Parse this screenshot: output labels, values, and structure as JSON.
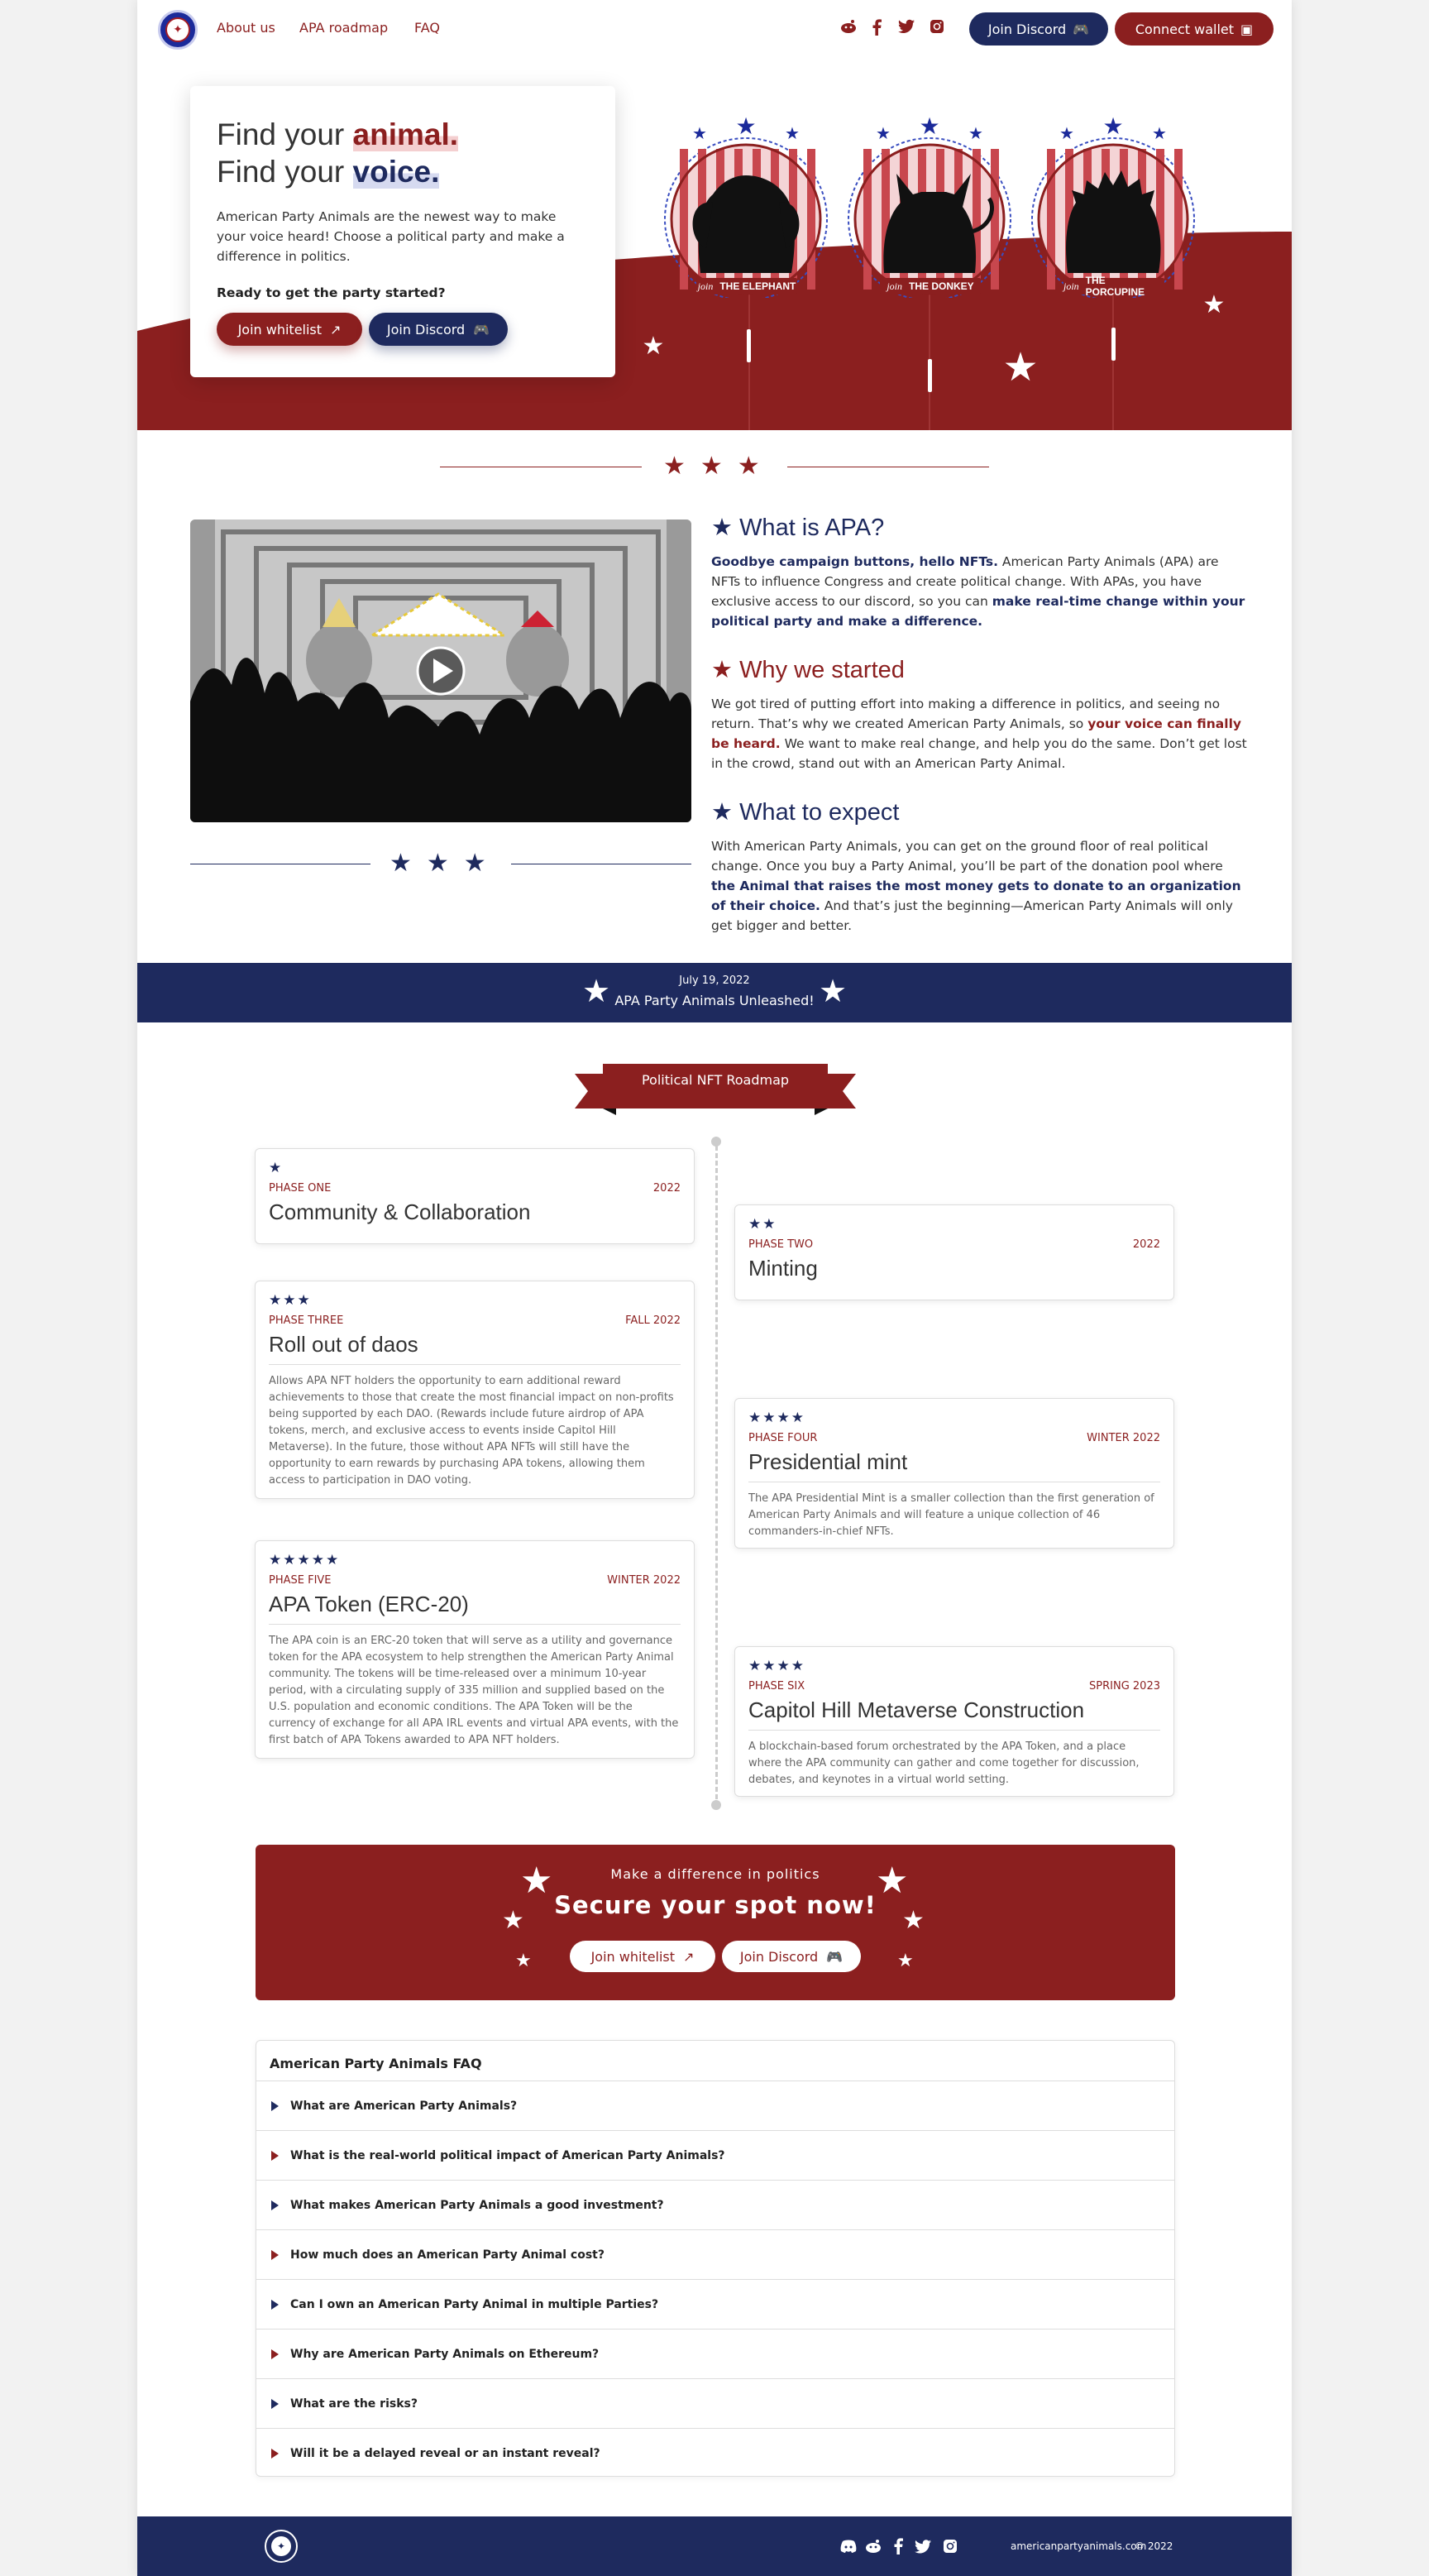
{
  "header": {
    "nav": [
      "About us",
      "APA roadmap",
      "FAQ"
    ],
    "join_discord": "Join Discord",
    "connect_wallet": "Connect wallet",
    "social_icons": [
      "reddit-icon",
      "facebook-icon",
      "twitter-icon",
      "instagram-icon"
    ]
  },
  "hero": {
    "line1_pre": "Find your ",
    "line1_hl": "animal.",
    "line2_pre": "Find your ",
    "line2_hl": "voice.",
    "body": "American Party Animals are the newest way to make your voice heard! Choose a political party and make a difference in politics.",
    "ready": "Ready to get the party started?",
    "join_whitelist": "Join whitelist",
    "join_discord": "Join Discord",
    "badges": [
      {
        "join": "join",
        "name": "THE ELEPHANT"
      },
      {
        "join": "join",
        "name": "THE DONKEY"
      },
      {
        "join": "join",
        "name": "THE PORCUPINE"
      }
    ]
  },
  "about": {
    "what_title": "What is APA?",
    "what_b1": "Goodbye campaign buttons, hello NFTs.",
    "what_t1": " American Party Animals (APA) are NFTs to influence Congress and create political change. With APAs, you have exclusive access to our discord, so you can ",
    "what_b2": "make real-time change within your political party and make a difference.",
    "why_title": "Why we started",
    "why_t1": "We got tired of putting effort into making a difference in politics, and seeing no return. That’s why we created American Party Animals, so ",
    "why_b1": "your voice can finally be heard.",
    "why_t2": " We want to make real change, and help you do the same. Don’t get lost in the crowd, stand out with an American Party Animal.",
    "expect_title": "What to expect",
    "expect_t1": "With American Party Animals, you can get on the ground floor of real political change. Once you buy a Party Animal, you’ll be part of the donation pool where ",
    "expect_b1": "the Animal that raises the most money gets to donate to an organization of their choice.",
    "expect_t2": " And that’s just the beginning—American Party Animals will only get bigger and better."
  },
  "banner": {
    "date": "July 19, 2022",
    "text": "APA Party Animals Unleashed!"
  },
  "roadmap": {
    "ribbon": "Political NFT Roadmap",
    "phases": [
      {
        "stars": "★",
        "phase": "PHASE ONE",
        "when": "2022",
        "title": "Community & Collaboration",
        "desc": ""
      },
      {
        "stars": "★★",
        "phase": "PHASE TWO",
        "when": "2022",
        "title": "Minting",
        "desc": ""
      },
      {
        "stars": "★★★",
        "phase": "PHASE THREE",
        "when": "FALL 2022",
        "title": "Roll out of daos",
        "desc": "Allows APA NFT holders the opportunity to earn additional reward achievements to those that create the most financial impact on non-profits being supported by each DAO. (Rewards include future airdrop of APA tokens, merch, and exclusive access to events inside Capitol Hill Metaverse). In the future, those without APA NFTs will still have the opportunity to earn rewards by purchasing APA tokens, allowing them access to participation in DAO voting."
      },
      {
        "stars": "★★★★",
        "phase": "PHASE FOUR",
        "when": "WINTER 2022",
        "title": "Presidential mint",
        "desc": "The APA Presidential Mint is a smaller collection than the first generation of American Party Animals and will feature a unique collection of 46 commanders-in-chief NFTs."
      },
      {
        "stars": "★★★★★",
        "phase": "PHASE FIVE",
        "when": "WINTER 2022",
        "title": "APA Token (ERC-20)",
        "desc": "The APA coin is an ERC-20 token that will serve as a utility and governance token for the APA ecosystem to help strengthen the American Party Animal community. The tokens will be time-released over a minimum 10-year period, with a circulating supply of 335 million and supplied based on the U.S. population and economic conditions. The APA Token will be the currency of exchange for all APA IRL events and virtual APA events, with the first batch of APA Tokens awarded to APA NFT holders."
      },
      {
        "stars": "★★★★",
        "phase": "PHASE SIX",
        "when": "SPRING 2023",
        "title": "Capitol Hill Metaverse Construction",
        "desc": "A blockchain-based forum orchestrated by the APA Token, and a place where the APA community can gather and come together for discussion, debates, and keynotes in a virtual world setting."
      }
    ]
  },
  "cta": {
    "kicker": "Make a difference in politics",
    "title": "Secure your spot now!",
    "join_whitelist": "Join whitelist",
    "join_discord": "Join Discord"
  },
  "faq": {
    "title": "American Party Animals FAQ",
    "items": [
      "What are American Party Animals?",
      "What is the real-world political impact of American Party Animals?",
      "What makes American Party Animals a good investment?",
      "How much does an American Party Animal cost?",
      "Can I own an American Party Animal in multiple Parties?",
      "Why are American Party Animals on Ethereum?",
      "What are the risks?",
      "Will it be a delayed reveal or an instant reveal?"
    ]
  },
  "footer": {
    "domain": "americanpartyanimals.com",
    "copyright": "© 2022"
  },
  "colors": {
    "red": "#8b1f1f",
    "navy": "#1e2a5e",
    "star_blue": "#1b2a9a"
  }
}
